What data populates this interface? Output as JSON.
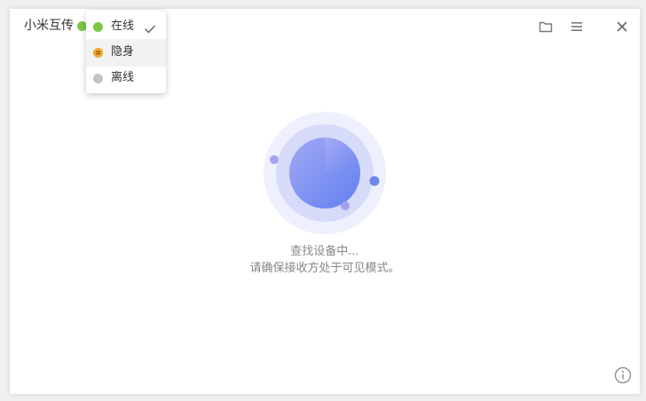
{
  "app": {
    "title": "小米互传",
    "status_color": "#7ac943"
  },
  "status_menu": {
    "items": [
      {
        "label": "在线",
        "color": "#7ac943",
        "selected": true,
        "icon": "online-dot"
      },
      {
        "label": "隐身",
        "color": "#f0a826",
        "selected": false,
        "icon": "invisible-dot"
      },
      {
        "label": "离线",
        "color": "#c4c4c4",
        "selected": false,
        "icon": "offline-dot"
      }
    ]
  },
  "toolbar": {
    "icons": [
      "folder-icon",
      "menu-icon",
      "close-icon"
    ]
  },
  "search": {
    "status_line": "查找设备中...",
    "hint_line": "请确保接收方处于可见模式。"
  },
  "colors": {
    "radar_outer": "#eef0fd",
    "radar_middle": "#d6dbfa",
    "radar_core": "#7b8cf2",
    "accent": "#6f86f0"
  }
}
